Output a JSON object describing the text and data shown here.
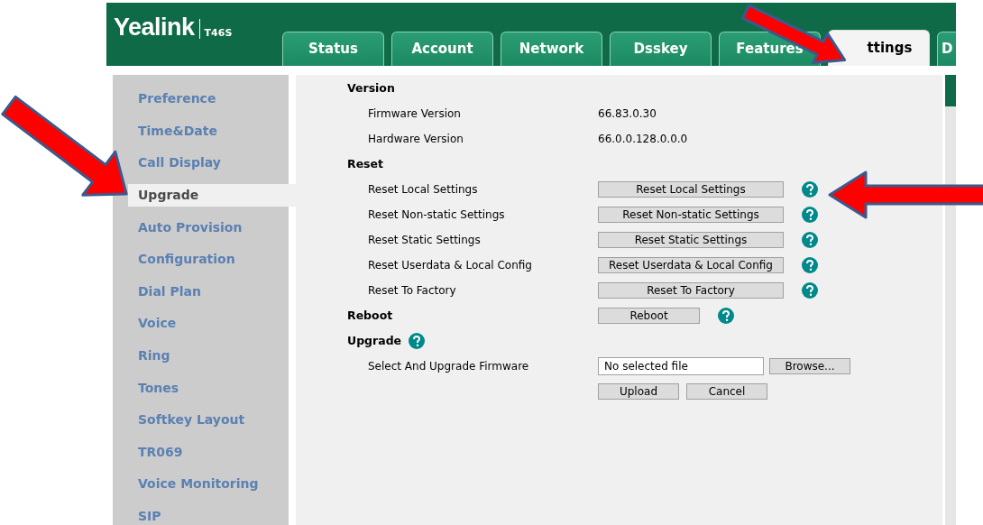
{
  "header": {
    "brand": "Yealink",
    "model": "T46S"
  },
  "tabs": [
    {
      "label": "Status",
      "selected": false
    },
    {
      "label": "Account",
      "selected": false
    },
    {
      "label": "Network",
      "selected": false
    },
    {
      "label": "Dsskey",
      "selected": false
    },
    {
      "label": "Features",
      "selected": false
    },
    {
      "label": "ttings",
      "selected": true
    },
    {
      "label": "D",
      "selected": false
    }
  ],
  "sidebar": {
    "items": [
      {
        "label": "Preference",
        "selected": false
      },
      {
        "label": "Time&Date",
        "selected": false
      },
      {
        "label": "Call Display",
        "selected": false
      },
      {
        "label": "Upgrade",
        "selected": true
      },
      {
        "label": "Auto Provision",
        "selected": false
      },
      {
        "label": "Configuration",
        "selected": false
      },
      {
        "label": "Dial Plan",
        "selected": false
      },
      {
        "label": "Voice",
        "selected": false
      },
      {
        "label": "Ring",
        "selected": false
      },
      {
        "label": "Tones",
        "selected": false
      },
      {
        "label": "Softkey Layout",
        "selected": false
      },
      {
        "label": "TR069",
        "selected": false
      },
      {
        "label": "Voice Monitoring",
        "selected": false
      },
      {
        "label": "SIP",
        "selected": false
      }
    ]
  },
  "rows": [
    {
      "kind": "heading",
      "label": "Version",
      "help": false
    },
    {
      "kind": "info",
      "label": "Firmware Version",
      "value": "66.83.0.30"
    },
    {
      "kind": "info",
      "label": "Hardware Version",
      "value": "66.0.0.128.0.0.0"
    },
    {
      "kind": "heading",
      "label": "Reset",
      "help": false
    },
    {
      "kind": "action",
      "label": "Reset Local Settings",
      "button": "Reset Local Settings",
      "help": true
    },
    {
      "kind": "action",
      "label": "Reset Non-static Settings",
      "button": "Reset Non-static Settings",
      "help": true
    },
    {
      "kind": "action",
      "label": "Reset Static Settings",
      "button": "Reset Static Settings",
      "help": true
    },
    {
      "kind": "action",
      "label": "Reset Userdata & Local Config",
      "button": "Reset Userdata & Local Config",
      "help": true
    },
    {
      "kind": "action",
      "label": "Reset To Factory",
      "button": "Reset To Factory",
      "help": true
    },
    {
      "kind": "heading-action",
      "label": "Reboot",
      "button": "Reboot",
      "help": true
    },
    {
      "kind": "heading",
      "label": "Upgrade",
      "help": true
    },
    {
      "kind": "file",
      "label": "Select And Upgrade Firmware",
      "value": "No selected file",
      "button": "Browse..."
    },
    {
      "kind": "buttons",
      "buttons": [
        "Upload",
        "Cancel"
      ]
    }
  ]
}
